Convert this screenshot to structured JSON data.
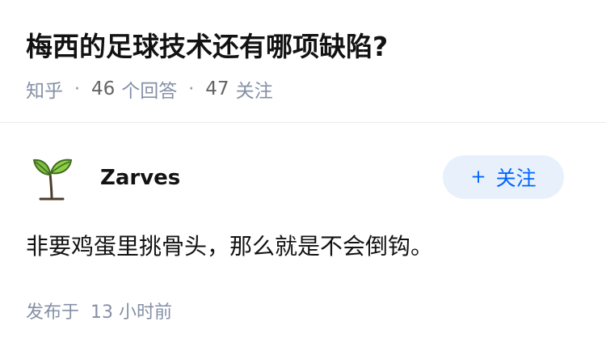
{
  "question": {
    "title": "梅西的足球技术还有哪项缺陷?",
    "meta": {
      "source": "知乎",
      "answer_count": "46",
      "answer_label": "个回答",
      "follow_count": "47",
      "follow_label": "关注"
    }
  },
  "answer": {
    "author": {
      "name": "Zarves",
      "avatar_icon": "sprout-icon"
    },
    "follow_button": {
      "icon": "plus-icon",
      "label": "关注"
    },
    "content": "非要鸡蛋里挑骨头，那么就是不会倒钩。",
    "time": {
      "prefix": "发布于",
      "value": "13 小时前"
    }
  },
  "colors": {
    "title_text": "#121212",
    "meta_text": "#8590a6",
    "follow_button_bg": "#e8f1fb",
    "follow_button_text": "#0066ff",
    "divider": "#ebebeb"
  }
}
